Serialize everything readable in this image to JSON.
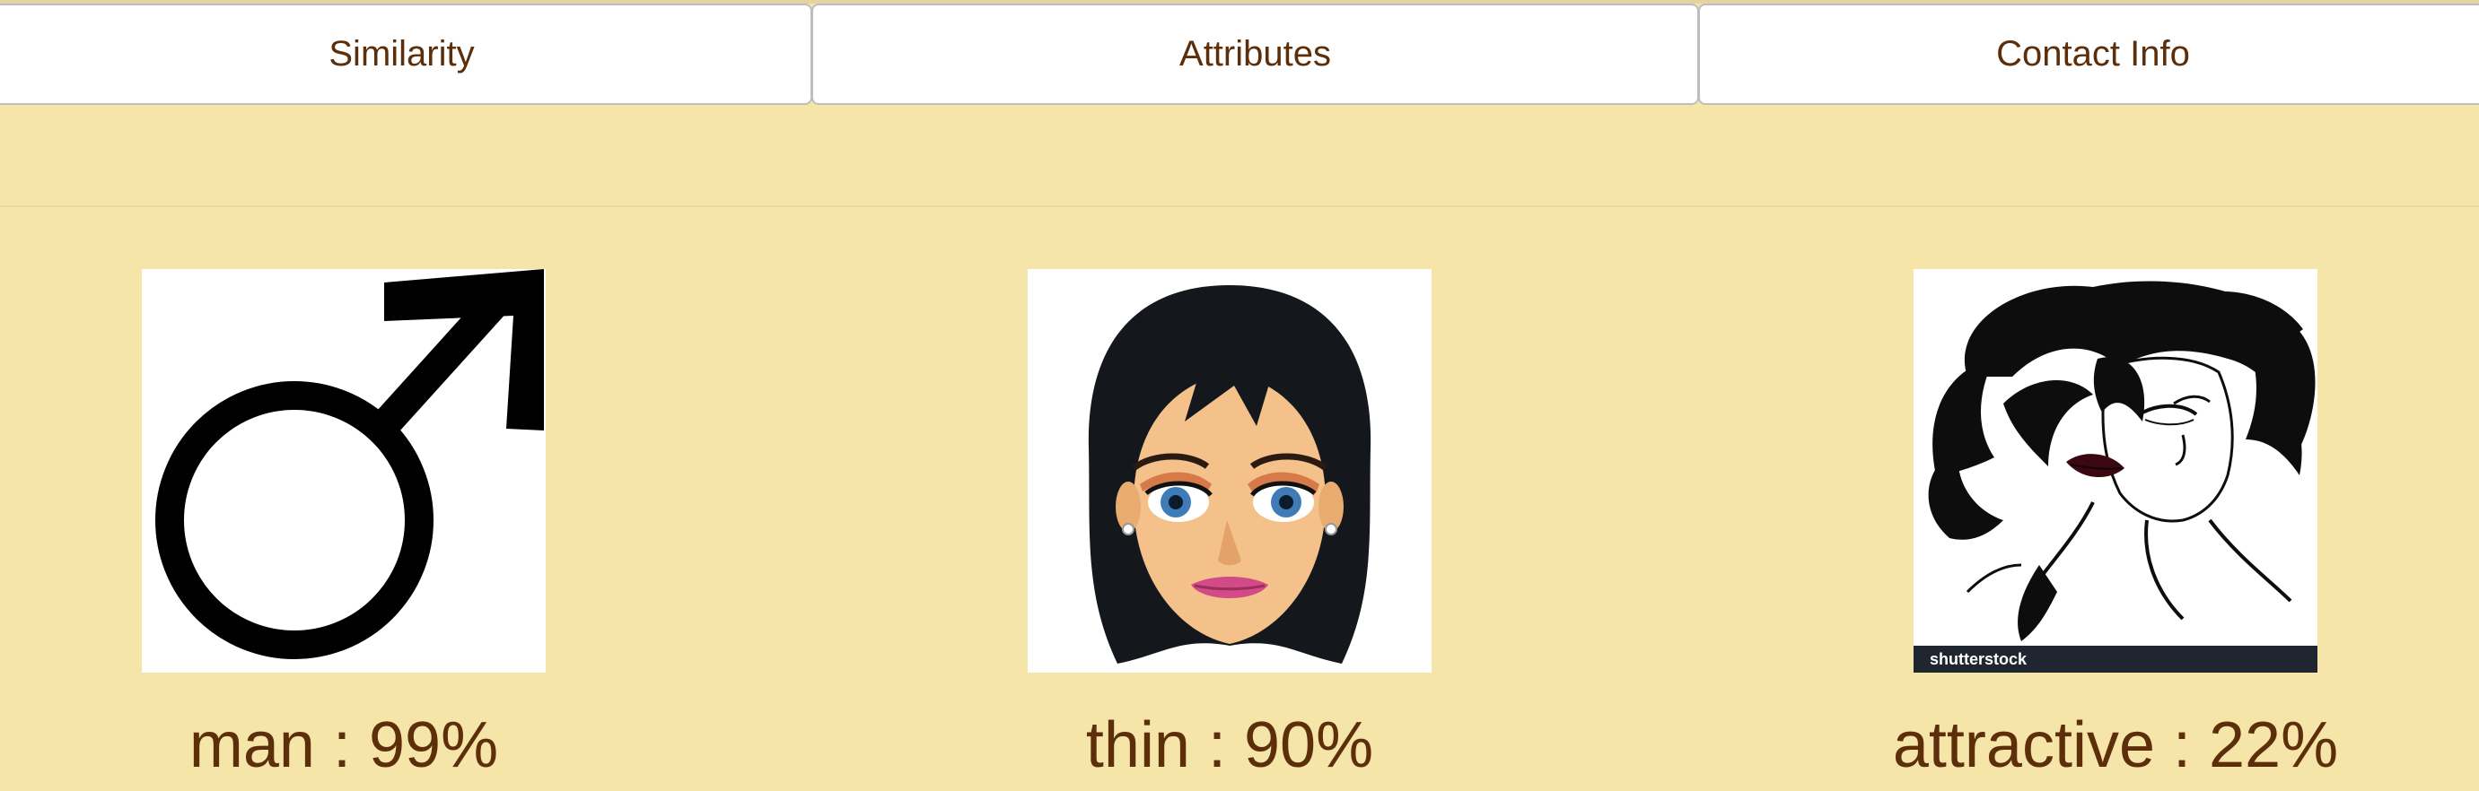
{
  "tabs": [
    {
      "label": "Similarity"
    },
    {
      "label": "Attributes"
    },
    {
      "label": "Contact Info"
    }
  ],
  "attributes": [
    {
      "name": "man",
      "percent": "99%",
      "icon": "male-symbol-icon"
    },
    {
      "name": "thin",
      "percent": "90%",
      "icon": "female-face-illustration"
    },
    {
      "name": "attractive",
      "percent": "22%",
      "icon": "woman-portrait-illustration",
      "watermark": "shutterstock"
    }
  ],
  "colors": {
    "background": "#f6e5a8",
    "text": "#5c2e0a",
    "tab_background": "#ffffff"
  }
}
